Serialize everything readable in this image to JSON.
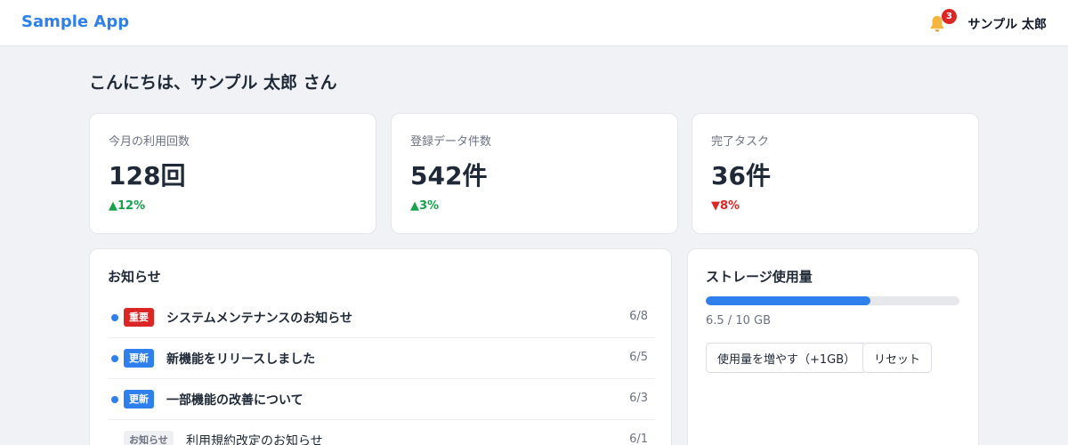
{
  "app": {
    "brand": "Sample App",
    "notification_count": "3",
    "user_name": "サンプル 太郎"
  },
  "greeting": "こんにちは、サンプル 太郎 さん",
  "stats": [
    {
      "label": "今月の利用回数",
      "value": "128回",
      "change": "▲12%",
      "direction": "up"
    },
    {
      "label": "登録データ件数",
      "value": "542件",
      "change": "▲3%",
      "direction": "up"
    },
    {
      "label": "完了タスク",
      "value": "36件",
      "change": "▼8%",
      "direction": "down"
    }
  ],
  "news": {
    "title": "お知らせ",
    "items": [
      {
        "tag": "重要",
        "tag_color": "#dc2626",
        "title": "システムメンテナンスのお知らせ",
        "date": "6/8",
        "unread": true
      },
      {
        "tag": "更新",
        "tag_color": "#2f80ed",
        "title": "新機能をリリースしました",
        "date": "6/5",
        "unread": true
      },
      {
        "tag": "更新",
        "tag_color": "#2f80ed",
        "title": "一部機能の改善について",
        "date": "6/3",
        "unread": true
      },
      {
        "tag": "お知らせ",
        "tag_color": "#eef0f3",
        "title": "利用規約改定のお知らせ",
        "date": "6/1",
        "unread": false
      }
    ]
  },
  "storage": {
    "title": "ストレージ使用量",
    "used": 6.5,
    "total": 10,
    "usage_text": "6.5 / 10 GB",
    "increase_label": "使用量を増やす（+1GB）",
    "reset_label": "リセット"
  },
  "colors": {
    "accent": "#2f80ed",
    "up": "#16a34a",
    "down": "#dc2626"
  },
  "icons": {
    "notification": "bell-icon"
  }
}
